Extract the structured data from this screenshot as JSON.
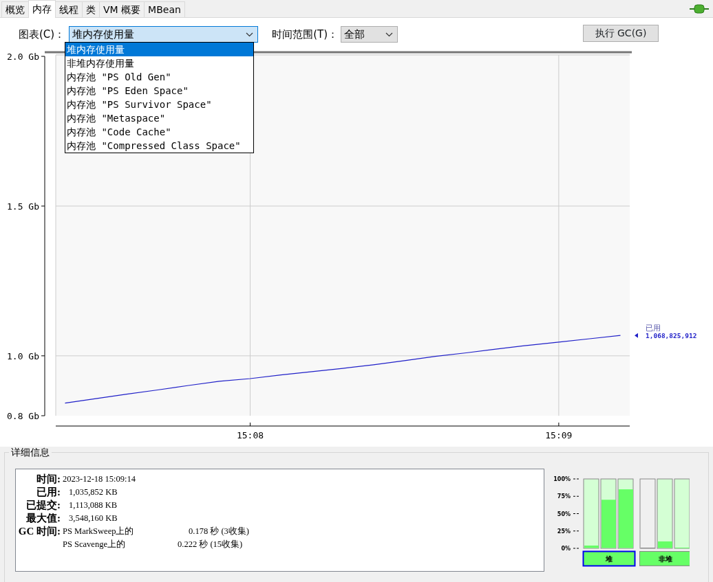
{
  "tabs": [
    {
      "label": "概览",
      "selected": false
    },
    {
      "label": "内存",
      "selected": true
    },
    {
      "label": "线程",
      "selected": false
    },
    {
      "label": "类",
      "selected": false
    },
    {
      "label": "VM 概要",
      "selected": false
    },
    {
      "label": "MBean",
      "selected": false
    }
  ],
  "chart_selector": {
    "label": "图表(C)：",
    "value": "堆内存使用量",
    "expanded": true,
    "options": [
      {
        "label": "堆内存使用量",
        "selected": true
      },
      {
        "label": "非堆内存使用量",
        "selected": false
      },
      {
        "label": "内存池 \"PS Old Gen\"",
        "selected": false
      },
      {
        "label": "内存池 \"PS Eden Space\"",
        "selected": false
      },
      {
        "label": "内存池 \"PS Survivor Space\"",
        "selected": false
      },
      {
        "label": "内存池 \"Metaspace\"",
        "selected": false
      },
      {
        "label": "内存池 \"Code Cache\"",
        "selected": false
      },
      {
        "label": "内存池 \"Compressed Class Space\"",
        "selected": false
      }
    ]
  },
  "time_range": {
    "label": "时间范围(T)：",
    "value": "全部"
  },
  "gc_button": "执行 GC(G)",
  "chart": {
    "chart_data": {
      "type": "line",
      "grid": true,
      "ylim": [
        0.8,
        2.0
      ],
      "categories": [
        null,
        null,
        null,
        null,
        null,
        null,
        "15:08",
        null,
        null,
        null,
        null,
        null,
        null,
        null,
        null,
        null,
        "15:09",
        null,
        null
      ],
      "yticks": [
        {
          "value": 0.8,
          "label": "0.8 Gb"
        },
        {
          "value": 1.0,
          "label": "1.0 Gb"
        },
        {
          "value": 1.5,
          "label": "1.5 Gb"
        },
        {
          "value": 2.0,
          "label": "2.0 Gb"
        }
      ],
      "series": [
        {
          "name": "已用",
          "color": "#1f1fc8",
          "values": [
            0.842,
            0.857,
            0.872,
            0.886,
            0.901,
            0.915,
            0.924,
            0.936,
            0.947,
            0.958,
            0.97,
            0.984,
            0.998,
            1.01,
            1.023,
            1.035,
            1.046,
            1.057,
            1.068
          ]
        }
      ],
      "annotations": [
        {
          "text": "1,068,825,912"
        }
      ]
    }
  },
  "details": {
    "title": "详细信息",
    "fields": [
      {
        "label": "时间:",
        "value": "2023-12-18 15:09:14"
      },
      {
        "label": "已用:",
        "value": "1,035,852 KB"
      },
      {
        "label": "已提交:",
        "value": "1,113,088 KB"
      },
      {
        "label": "最大值:",
        "value": "3,548,160 KB"
      }
    ],
    "gc": {
      "label": "GC 时间:",
      "rows": [
        {
          "collector": "PS MarkSweep上的",
          "time": "0.178 秒 (3收集)"
        },
        {
          "collector": "PS Scavenge上的",
          "time": "0.222 秒 (15收集)"
        }
      ]
    }
  },
  "gauges": {
    "ticks": [
      "100%",
      "75%",
      "50%",
      "25%",
      "0%"
    ],
    "groups": [
      {
        "label": "堆",
        "selected": true,
        "bars": [
          {
            "level": 0.04
          },
          {
            "level": 0.7
          },
          {
            "level": 0.85
          }
        ]
      },
      {
        "label": "非堆",
        "selected": false,
        "bars": [
          {
            "level": 0
          },
          {
            "level": 0.1
          },
          {
            "level": 0.01
          }
        ]
      }
    ]
  }
}
